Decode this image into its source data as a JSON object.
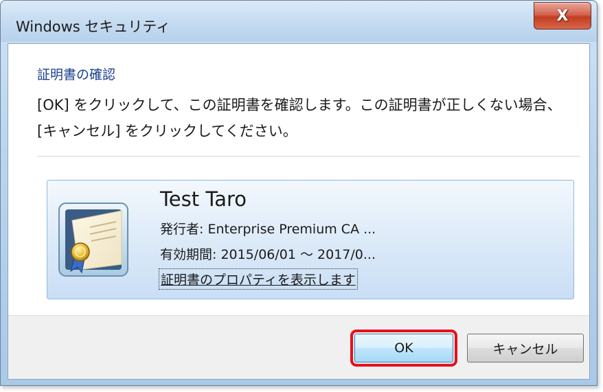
{
  "window": {
    "title": "Windows セキュリティ",
    "close_label": "X"
  },
  "dialog": {
    "heading": "証明書の確認",
    "message": "[OK] をクリックして、この証明書を確認します。この証明書が正しくない場合、[キャンセル] をクリックしてください。"
  },
  "certificate": {
    "name": "Test Taro",
    "issuer": "発行者: Enterprise Premium CA ...",
    "validity": "有効期間: 2015/06/01 ～ 2017/0...",
    "properties_link": "証明書のプロパティを表示します",
    "icon": "certificate-icon"
  },
  "buttons": {
    "ok": "OK",
    "cancel": "キャンセル"
  },
  "colors": {
    "heading": "#1a3e8c",
    "highlight": "#e8101a",
    "close_button": "#c23d22"
  }
}
